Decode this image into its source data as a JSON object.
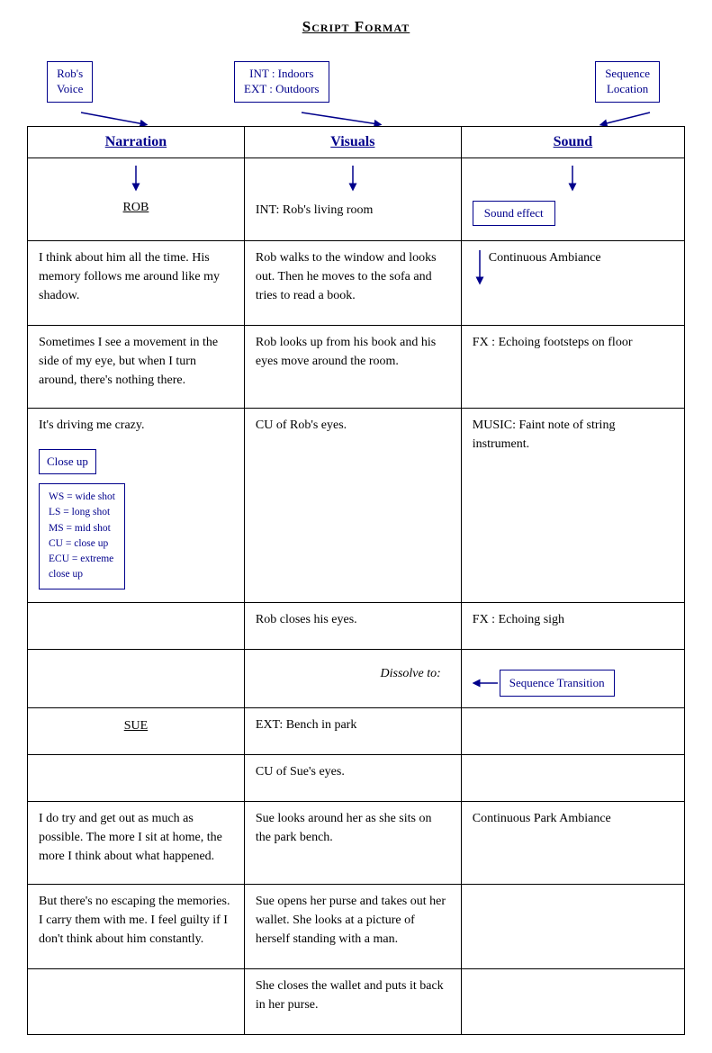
{
  "title": "Script Format",
  "annotations": {
    "robs_voice": "Rob's\nVoice",
    "int_ext": "INT : Indoors\nEXT : Outdoors",
    "sequence_location": "Sequence\nLocation",
    "sound_effect": "Sound effect",
    "close_up": "Close up",
    "closeup_detail": "WS = wide shot\nLS = long shot\nMS = mid shot\nCU = close up\nECU = extreme\nclose up",
    "sequence_transition": "Sequence Transition"
  },
  "columns": {
    "narration": "Narration",
    "visuals": "Visuals",
    "sound": "Sound"
  },
  "rows": [
    {
      "narration": "ROB",
      "narration_type": "char",
      "visuals": "INT: Rob's living room",
      "visuals_type": "normal",
      "sound": "",
      "sound_type": "effect_box"
    },
    {
      "narration": "I think about him all the time. His memory follows me around like my shadow.",
      "narration_type": "para",
      "visuals": "Rob walks to the window and looks out. Then he moves to the sofa and tries to read a book.",
      "visuals_type": "normal",
      "sound": "Continuous Ambiance",
      "sound_type": "normal"
    },
    {
      "narration": "Sometimes I see a movement in the side of my eye, but when I turn around, there's nothing there.",
      "narration_type": "para",
      "visuals": "Rob looks up from his book and his eyes move around the room.",
      "visuals_type": "normal",
      "sound": "FX : Echoing footsteps on floor",
      "sound_type": "normal"
    },
    {
      "narration": "It's driving me crazy.",
      "narration_type": "para",
      "visuals": "CU of Rob's eyes.",
      "visuals_type": "normal",
      "sound": "MUSIC: Faint note of string instrument.",
      "sound_type": "normal"
    },
    {
      "narration": "",
      "narration_type": "closeup_box",
      "visuals": "Rob closes his eyes.",
      "visuals_type": "normal",
      "sound": "FX : Echoing sigh",
      "sound_type": "normal"
    },
    {
      "narration": "",
      "narration_type": "empty",
      "visuals": "Dissolve to:",
      "visuals_type": "italic",
      "sound": "",
      "sound_type": "seq_transition"
    },
    {
      "narration": "SUE",
      "narration_type": "char",
      "visuals": "EXT: Bench in park",
      "visuals_type": "normal",
      "sound": "",
      "sound_type": "empty"
    },
    {
      "narration": "",
      "narration_type": "empty2",
      "visuals": "CU of Sue's eyes.",
      "visuals_type": "normal",
      "sound": "",
      "sound_type": "empty"
    },
    {
      "narration": "I do try and get out as much as possible. The more I sit at home, the more I think about what happened.",
      "narration_type": "para",
      "visuals": "Sue looks around her as she sits on the park bench.",
      "visuals_type": "normal",
      "sound": "Continuous Park Ambiance",
      "sound_type": "normal"
    },
    {
      "narration": "But there's no escaping the memories. I carry them with me. I feel guilty if I don't think about him constantly.",
      "narration_type": "para",
      "visuals": "Sue opens her purse and takes out her wallet. She looks at a picture of herself standing with a man.",
      "visuals_type": "normal",
      "sound": "",
      "sound_type": "empty"
    },
    {
      "narration": "",
      "narration_type": "empty",
      "visuals": "She closes the wallet and puts it back in her purse.",
      "visuals_type": "normal",
      "sound": "",
      "sound_type": "empty"
    }
  ]
}
